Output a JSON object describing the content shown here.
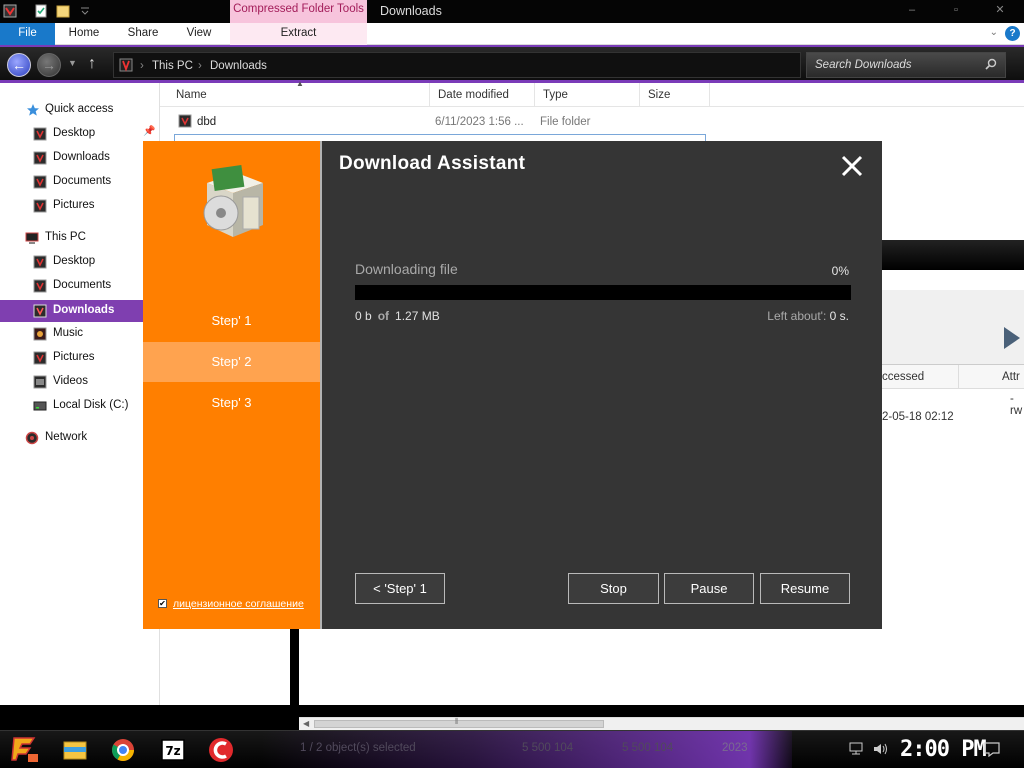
{
  "window": {
    "title": "Downloads",
    "context_tab": "Compressed Folder Tools",
    "controls": [
      "–",
      "▫",
      "✕"
    ]
  },
  "ribbon": {
    "tabs": [
      "File",
      "Home",
      "Share",
      "View"
    ],
    "context_tab": "Extract"
  },
  "address": {
    "crumbs": [
      "This PC",
      "Downloads"
    ],
    "search_placeholder": "Search Downloads"
  },
  "nav": {
    "items": [
      {
        "label": "Quick access",
        "icon": "star-icon"
      },
      {
        "label": "Desktop",
        "icon": "folder-icon",
        "pinned": true
      },
      {
        "label": "Downloads",
        "icon": "folder-icon"
      },
      {
        "label": "Documents",
        "icon": "folder-icon"
      },
      {
        "label": "Pictures",
        "icon": "folder-icon"
      },
      {
        "label": "This PC",
        "icon": "computer-icon"
      },
      {
        "label": "Desktop",
        "icon": "folder-icon"
      },
      {
        "label": "Documents",
        "icon": "folder-icon"
      },
      {
        "label": "Downloads",
        "icon": "folder-icon",
        "selected": true
      },
      {
        "label": "Music",
        "icon": "music-icon"
      },
      {
        "label": "Pictures",
        "icon": "folder-icon"
      },
      {
        "label": "Videos",
        "icon": "video-icon"
      },
      {
        "label": "Local Disk (C:)",
        "icon": "drive-icon"
      },
      {
        "label": "Network",
        "icon": "network-icon"
      }
    ]
  },
  "filelist": {
    "columns": [
      "Name",
      "Date modified",
      "Type",
      "Size"
    ],
    "rows": [
      {
        "name": "dbd",
        "date": "6/11/2023 1:56 ...",
        "type": "File folder",
        "size": ""
      }
    ]
  },
  "background_window": {
    "columns": [
      "ccessed",
      "Attr"
    ],
    "row": {
      "accessed": "2-05-18 02:12",
      "attr": "-rw"
    }
  },
  "dialog": {
    "title": "Download Assistant",
    "steps": [
      "Step' 1",
      "Step' 2",
      "Step' 3"
    ],
    "active_step": 1,
    "license_text": "лицензионное соглашение",
    "license_checked": true,
    "downloading_label": "Downloading file",
    "percent_text": "0%",
    "progress": 0,
    "downloaded": "0 b",
    "of_label": "of",
    "total": "1.27 MB",
    "left_label": "Left about':",
    "left_value": "0 s.",
    "buttons": {
      "back": "< 'Step' 1",
      "stop": "Stop",
      "pause": "Pause",
      "resume": "Resume"
    },
    "colors": {
      "accent": "#ff7f00",
      "panel": "#353535"
    }
  },
  "statusbar_ghost": {
    "selection": "1 / 2 object(s) selected",
    "size_a": "5 500 104",
    "size_b": "5 500 104",
    "date": "2023"
  },
  "taskbar": {
    "apps": [
      {
        "name": "file-explorer-icon"
      },
      {
        "name": "chrome-icon"
      },
      {
        "name": "7zip-icon",
        "label": "7z"
      },
      {
        "name": "ccleaner-icon"
      }
    ],
    "clock": "2:00 PM"
  }
}
